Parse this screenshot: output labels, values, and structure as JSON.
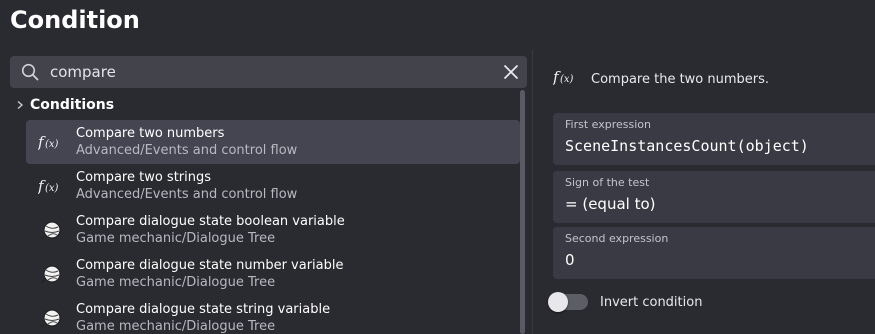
{
  "dialog": {
    "title": "Condition"
  },
  "search": {
    "value": "compare",
    "icon": "search-icon",
    "clear_icon": "close-icon"
  },
  "tree": {
    "group_label": "Conditions",
    "items": [
      {
        "name": "Compare two numbers",
        "path": "Advanced/Events and control flow",
        "icon": "function-icon",
        "selected": true
      },
      {
        "name": "Compare two strings",
        "path": "Advanced/Events and control flow",
        "icon": "function-icon",
        "selected": false
      },
      {
        "name": "Compare dialogue state boolean variable",
        "path": "Game mechanic/Dialogue Tree",
        "icon": "yarn-ball-icon",
        "selected": false
      },
      {
        "name": "Compare dialogue state number variable",
        "path": "Game mechanic/Dialogue Tree",
        "icon": "yarn-ball-icon",
        "selected": false
      },
      {
        "name": "Compare dialogue state string variable",
        "path": "Game mechanic/Dialogue Tree",
        "icon": "yarn-ball-icon",
        "selected": false
      }
    ]
  },
  "details": {
    "description": "Compare the two numbers.",
    "fields": [
      {
        "label": "First expression",
        "value": "SceneInstancesCount(object)"
      },
      {
        "label": "Sign of the test",
        "value": "= (equal to)"
      },
      {
        "label": "Second expression",
        "value": "0"
      }
    ],
    "invert": {
      "label": "Invert condition",
      "checked": false
    }
  },
  "colors": {
    "background": "#2a2a31",
    "selected_row": "#454552",
    "field_bg": "#3a3a44"
  }
}
